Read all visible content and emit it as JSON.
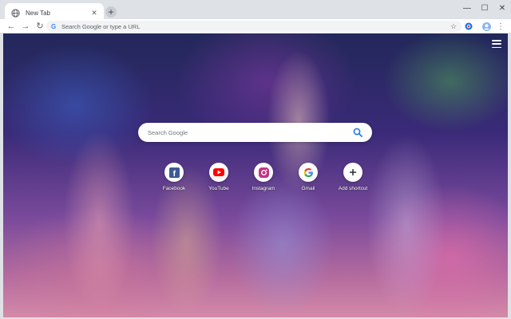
{
  "browser": {
    "tab": {
      "title": "New Tab",
      "close_glyph": "✕"
    },
    "new_tab_glyph": "+",
    "window_controls": {
      "minimize": "—",
      "maximize": "☐",
      "close": "✕"
    },
    "toolbar": {
      "back_glyph": "←",
      "forward_glyph": "→",
      "reload_glyph": "↻",
      "omnibox_placeholder": "Search Google or type a URL",
      "star_glyph": "☆",
      "menu_glyph": "⋮"
    }
  },
  "newtab": {
    "search_placeholder": "Search Google",
    "shortcuts": [
      {
        "label": "Facebook",
        "icon": "facebook-icon",
        "color": "#3b5998"
      },
      {
        "label": "YouTube",
        "icon": "youtube-icon",
        "color": "#ff0000"
      },
      {
        "label": "Instagram",
        "icon": "instagram-icon",
        "color": "#c13584"
      },
      {
        "label": "Gmail",
        "icon": "google-icon",
        "color": "#4285f4"
      },
      {
        "label": "Add shortcut",
        "icon": "plus-icon",
        "color": "#202124"
      }
    ]
  },
  "colors": {
    "tabstrip": "#dee1e6",
    "toolbar": "#ffffff",
    "omnibox": "#f1f3f4",
    "accent": "#1a73e8"
  }
}
